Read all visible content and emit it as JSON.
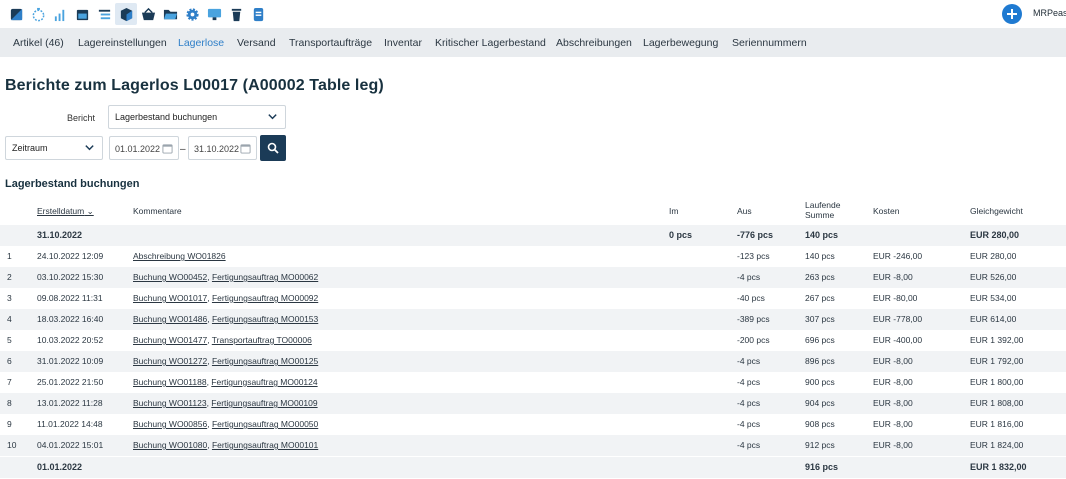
{
  "toolbar": {
    "icons": [
      "dashboard-icon",
      "timer-icon",
      "stats-icon",
      "calendar-icon",
      "list-icon",
      "inventory-cube-icon",
      "basket-icon",
      "folder-icon",
      "settings-gear-icon",
      "monitor-icon",
      "trash-icon",
      "document-icon"
    ],
    "user": "MRPeasy"
  },
  "nav": {
    "tabs": [
      "Artikel (46)",
      "Lagereinstellungen",
      "Lagerlose",
      "Versand",
      "Transportaufträge",
      "Inventar",
      "Kritischer Lagerbestand",
      "Abschreibungen",
      "Lagerbewegung",
      "Seriennummern"
    ],
    "active": "Lagerlose"
  },
  "page_title": "Berichte zum Lagerlos L00017 (A00002 Table leg)",
  "filters": {
    "report_label": "Bericht",
    "report_value": "Lagerbestand buchungen",
    "period_value": "Zeitraum",
    "date_from": "01.01.2022",
    "date_sep": "–",
    "date_to": "31.10.2022"
  },
  "section_title": "Lagerbestand buchungen",
  "table": {
    "headers": {
      "date": "Erstelldatum",
      "comment": "Kommentare",
      "in": "Im",
      "out": "Aus",
      "running_1": "Laufende",
      "running_2": "Summe",
      "cost": "Kosten",
      "balance": "Gleichgewicht"
    },
    "summary_top": {
      "date": "31.10.2022",
      "in": "0 pcs",
      "out": "-776 pcs",
      "running": "140 pcs",
      "balance": "EUR 280,00"
    },
    "rows": [
      {
        "n": "1",
        "date": "24.10.2022 12:09",
        "c1": "Abschreibung WO01826",
        "sep": "",
        "c2": "",
        "out": "-123 pcs",
        "running": "140 pcs",
        "cost": "EUR -246,00",
        "balance": "EUR 280,00"
      },
      {
        "n": "2",
        "date": "03.10.2022 15:30",
        "c1": "Buchung WO00452",
        "sep": ", ",
        "c2": "Fertigungsauftrag MO00062",
        "out": "-4 pcs",
        "running": "263 pcs",
        "cost": "EUR -8,00",
        "balance": "EUR 526,00"
      },
      {
        "n": "3",
        "date": "09.08.2022 11:31",
        "c1": "Buchung WO01017",
        "sep": ", ",
        "c2": "Fertigungsauftrag MO00092",
        "out": "-40 pcs",
        "running": "267 pcs",
        "cost": "EUR -80,00",
        "balance": "EUR 534,00"
      },
      {
        "n": "4",
        "date": "18.03.2022 16:40",
        "c1": "Buchung WO01486",
        "sep": ", ",
        "c2": "Fertigungsauftrag MO00153",
        "out": "-389 pcs",
        "running": "307 pcs",
        "cost": "EUR -778,00",
        "balance": "EUR 614,00"
      },
      {
        "n": "5",
        "date": "10.03.2022 20:52",
        "c1": "Buchung WO01477",
        "sep": ", ",
        "c2": "Transportauftrag TO00006",
        "out": "-200 pcs",
        "running": "696 pcs",
        "cost": "EUR -400,00",
        "balance": "EUR 1 392,00"
      },
      {
        "n": "6",
        "date": "31.01.2022 10:09",
        "c1": "Buchung WO01272",
        "sep": ", ",
        "c2": "Fertigungsauftrag MO00125",
        "out": "-4 pcs",
        "running": "896 pcs",
        "cost": "EUR -8,00",
        "balance": "EUR 1 792,00"
      },
      {
        "n": "7",
        "date": "25.01.2022 21:50",
        "c1": "Buchung WO01188",
        "sep": ", ",
        "c2": "Fertigungsauftrag MO00124",
        "out": "-4 pcs",
        "running": "900 pcs",
        "cost": "EUR -8,00",
        "balance": "EUR 1 800,00"
      },
      {
        "n": "8",
        "date": "13.01.2022 11:28",
        "c1": "Buchung WO01123",
        "sep": ", ",
        "c2": "Fertigungsauftrag MO00109",
        "out": "-4 pcs",
        "running": "904 pcs",
        "cost": "EUR -8,00",
        "balance": "EUR 1 808,00"
      },
      {
        "n": "9",
        "date": "11.01.2022 14:48",
        "c1": "Buchung WO00856",
        "sep": ", ",
        "c2": "Fertigungsauftrag MO00050",
        "out": "-4 pcs",
        "running": "908 pcs",
        "cost": "EUR -8,00",
        "balance": "EUR 1 816,00"
      },
      {
        "n": "10",
        "date": "04.01.2022 15:01",
        "c1": "Buchung WO01080",
        "sep": ", ",
        "c2": "Fertigungsauftrag MO00101",
        "out": "-4 pcs",
        "running": "912 pcs",
        "cost": "EUR -8,00",
        "balance": "EUR 1 824,00"
      }
    ],
    "summary_bottom": {
      "date": "01.01.2022",
      "running": "916 pcs",
      "balance": "EUR 1 832,00"
    }
  },
  "colors": {
    "accent": "#2f7fc8",
    "nav_bg": "#e9ecef",
    "dark_button": "#1b3b57",
    "row_shade": "#f1f3f5"
  }
}
